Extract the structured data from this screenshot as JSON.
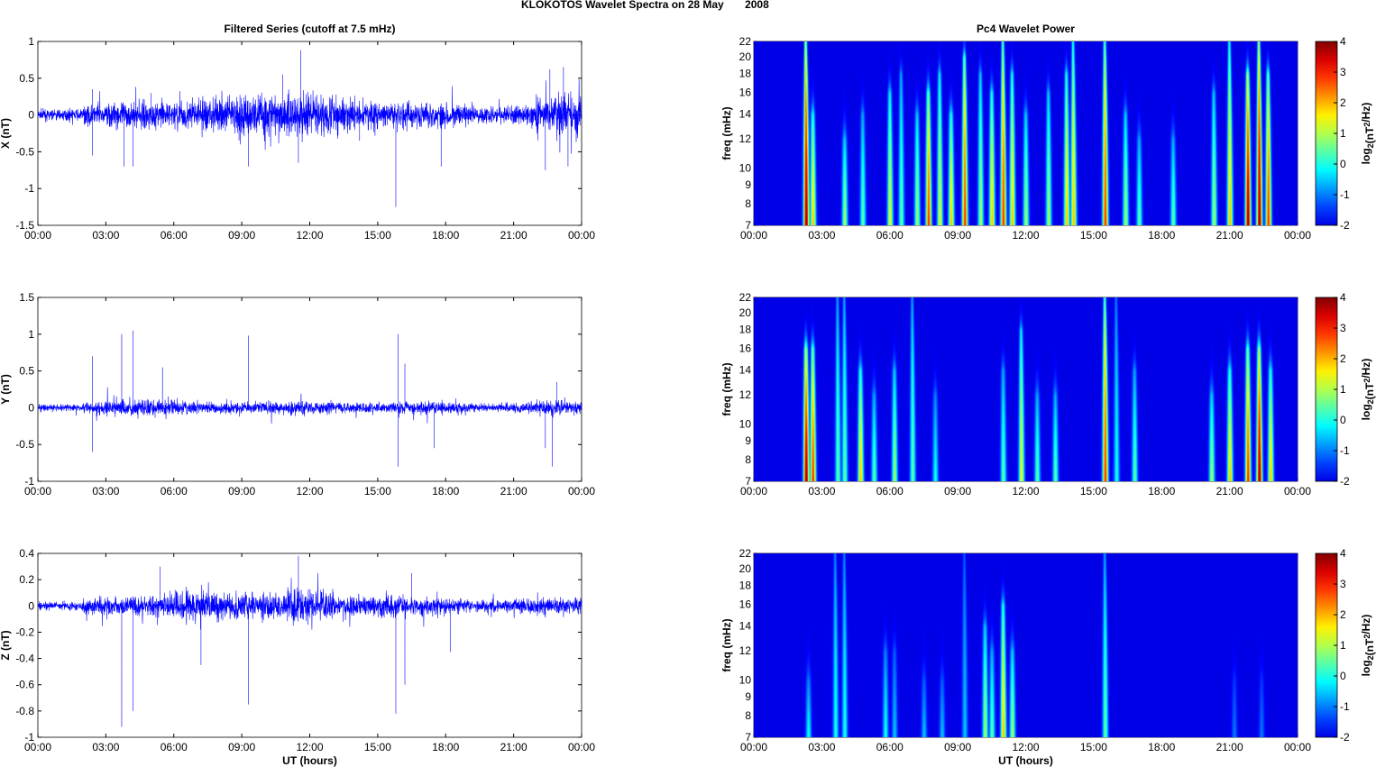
{
  "title": "KLOKOTOS Wavelet Spectra on 28 May       2008",
  "chart_data": [
    {
      "type": "line",
      "title": "Filtered Series (cutoff at 7.5 mHz)",
      "ylabel": "X (nT)",
      "xlabel": "",
      "ylim": [
        -1.5,
        1
      ],
      "yticks": [
        "1",
        "0.5",
        "0",
        "-0.5",
        "-1",
        "-1.5"
      ],
      "xticks": [
        "00:00",
        "03:00",
        "06:00",
        "09:00",
        "12:00",
        "15:00",
        "18:00",
        "21:00",
        "00:00"
      ],
      "hourly_amplitude": [
        0.05,
        0.05,
        0.1,
        0.12,
        0.12,
        0.12,
        0.13,
        0.15,
        0.17,
        0.2,
        0.2,
        0.22,
        0.18,
        0.15,
        0.13,
        0.12,
        0.12,
        0.12,
        0.1,
        0.08,
        0.08,
        0.1,
        0.16,
        0.2
      ],
      "spikes": [
        [
          2.4,
          -0.55
        ],
        [
          2.4,
          0.35
        ],
        [
          3.8,
          -0.7
        ],
        [
          4.2,
          -0.7
        ],
        [
          5.0,
          0.3
        ],
        [
          9.3,
          -0.7
        ],
        [
          11.6,
          0.88
        ],
        [
          11.5,
          -0.65
        ],
        [
          14.2,
          -0.35
        ],
        [
          15.8,
          -1.25
        ],
        [
          17.8,
          -0.7
        ],
        [
          22.4,
          -0.75
        ],
        [
          22.6,
          0.62
        ],
        [
          23.2,
          0.65
        ],
        [
          23.4,
          -0.7
        ],
        [
          10.8,
          0.55
        ]
      ]
    },
    {
      "type": "line",
      "title": "",
      "ylabel": "Y (nT)",
      "xlabel": "",
      "ylim": [
        -1,
        1.5
      ],
      "yticks": [
        "1.5",
        "1",
        "0.5",
        "0",
        "-0.5",
        "-1"
      ],
      "xticks": [
        "00:00",
        "03:00",
        "06:00",
        "09:00",
        "12:00",
        "15:00",
        "18:00",
        "21:00",
        "00:00"
      ],
      "hourly_amplitude": [
        0.03,
        0.03,
        0.06,
        0.08,
        0.08,
        0.07,
        0.06,
        0.05,
        0.05,
        0.05,
        0.06,
        0.07,
        0.06,
        0.05,
        0.05,
        0.05,
        0.06,
        0.06,
        0.05,
        0.04,
        0.04,
        0.05,
        0.07,
        0.06
      ],
      "spikes": [
        [
          2.4,
          0.7
        ],
        [
          2.4,
          -0.6
        ],
        [
          3.7,
          1.0
        ],
        [
          4.2,
          1.05
        ],
        [
          5.5,
          0.55
        ],
        [
          9.3,
          0.98
        ],
        [
          15.9,
          1.0
        ],
        [
          15.9,
          -0.8
        ],
        [
          16.2,
          0.6
        ],
        [
          17.5,
          -0.55
        ],
        [
          22.4,
          -0.55
        ],
        [
          22.7,
          -0.8
        ],
        [
          22.9,
          0.35
        ]
      ]
    },
    {
      "type": "line",
      "title": "",
      "ylabel": "Z (nT)",
      "xlabel": "UT (hours)",
      "ylim": [
        -1,
        0.4
      ],
      "yticks": [
        "0.4",
        "0.2",
        "0",
        "-0.2",
        "-0.4",
        "-0.6",
        "-0.8",
        "-1"
      ],
      "xticks": [
        "00:00",
        "03:00",
        "06:00",
        "09:00",
        "12:00",
        "15:00",
        "18:00",
        "21:00",
        "00:00"
      ],
      "hourly_amplitude": [
        0.02,
        0.02,
        0.04,
        0.05,
        0.05,
        0.06,
        0.08,
        0.08,
        0.07,
        0.07,
        0.07,
        0.09,
        0.08,
        0.05,
        0.05,
        0.06,
        0.05,
        0.05,
        0.04,
        0.03,
        0.03,
        0.04,
        0.04,
        0.04
      ],
      "spikes": [
        [
          3.7,
          -0.92
        ],
        [
          4.2,
          -0.8
        ],
        [
          7.2,
          -0.45
        ],
        [
          9.3,
          -0.75
        ],
        [
          11.5,
          0.38
        ],
        [
          15.8,
          -0.82
        ],
        [
          16.2,
          -0.6
        ],
        [
          16.5,
          0.25
        ],
        [
          18.2,
          -0.35
        ],
        [
          5.4,
          0.3
        ]
      ]
    },
    {
      "type": "heatmap",
      "title": "Pc4 Wavelet Power",
      "ylabel": "freq (mHz)",
      "xlabel": "",
      "ylim": [
        7,
        22
      ],
      "yscale": "log",
      "clim": [
        -2,
        4
      ],
      "colorbar_label": "log2(nT2/Hz)",
      "colorbar_ticks": [
        "4",
        "3",
        "2",
        "1",
        "0",
        "-1",
        "-2"
      ],
      "yticks": [
        "22",
        "20",
        "18",
        "16",
        "14",
        "12",
        "10",
        "9",
        "8",
        "7"
      ],
      "xticks": [
        "00:00",
        "03:00",
        "06:00",
        "09:00",
        "12:00",
        "15:00",
        "18:00",
        "21:00",
        "00:00"
      ],
      "events": [
        [
          2.3,
          4,
          22
        ],
        [
          2.6,
          2,
          14
        ],
        [
          4.0,
          1,
          12
        ],
        [
          4.8,
          0.5,
          14
        ],
        [
          6.0,
          1.5,
          16
        ],
        [
          6.5,
          0.5,
          18
        ],
        [
          7.2,
          1,
          14
        ],
        [
          7.7,
          3,
          16
        ],
        [
          8.2,
          1.5,
          18
        ],
        [
          8.7,
          2,
          14
        ],
        [
          9.3,
          3,
          20
        ],
        [
          10.0,
          1,
          18
        ],
        [
          10.5,
          2,
          16
        ],
        [
          11.0,
          3,
          22
        ],
        [
          11.4,
          2,
          18
        ],
        [
          12.0,
          1,
          14
        ],
        [
          13.0,
          1,
          16
        ],
        [
          13.8,
          2,
          18
        ],
        [
          14.1,
          2,
          22
        ],
        [
          15.5,
          3,
          22
        ],
        [
          16.4,
          1,
          14
        ],
        [
          17.0,
          0.5,
          12
        ],
        [
          18.5,
          0.5,
          12
        ],
        [
          20.3,
          1,
          16
        ],
        [
          21.0,
          2,
          22
        ],
        [
          21.8,
          4,
          18
        ],
        [
          22.3,
          4,
          22
        ],
        [
          22.7,
          3,
          18
        ]
      ]
    },
    {
      "type": "heatmap",
      "title": "",
      "ylabel": "freq (mHz)",
      "xlabel": "",
      "ylim": [
        7,
        22
      ],
      "yscale": "log",
      "clim": [
        -2,
        4
      ],
      "colorbar_label": "log2(nT2/Hz)",
      "colorbar_ticks": [
        "4",
        "3",
        "2",
        "1",
        "0",
        "-1",
        "-2"
      ],
      "yticks": [
        "22",
        "20",
        "18",
        "16",
        "14",
        "12",
        "10",
        "9",
        "8",
        "7"
      ],
      "xticks": [
        "00:00",
        "03:00",
        "06:00",
        "09:00",
        "12:00",
        "15:00",
        "18:00",
        "21:00",
        "00:00"
      ],
      "events": [
        [
          2.3,
          4,
          16
        ],
        [
          2.6,
          3,
          16
        ],
        [
          3.7,
          0.5,
          22
        ],
        [
          4.0,
          0.5,
          22
        ],
        [
          4.7,
          2,
          14
        ],
        [
          5.3,
          0.5,
          12
        ],
        [
          6.2,
          1,
          14
        ],
        [
          7.0,
          0.5,
          22
        ],
        [
          8.0,
          0,
          12
        ],
        [
          11.0,
          0.5,
          14
        ],
        [
          11.8,
          1.5,
          18
        ],
        [
          12.5,
          0.5,
          12
        ],
        [
          13.3,
          0.5,
          12
        ],
        [
          15.5,
          3,
          22
        ],
        [
          16.0,
          0,
          22
        ],
        [
          16.8,
          0.5,
          14
        ],
        [
          20.2,
          1,
          12
        ],
        [
          21.0,
          2,
          14
        ],
        [
          21.8,
          3,
          16
        ],
        [
          22.3,
          4,
          16
        ],
        [
          22.8,
          2,
          14
        ]
      ]
    },
    {
      "type": "heatmap",
      "title": "",
      "ylabel": "freq (mHz)",
      "xlabel": "UT (hours)",
      "ylim": [
        7,
        22
      ],
      "yscale": "log",
      "clim": [
        -2,
        4
      ],
      "colorbar_label": "log2(nT2/Hz)",
      "colorbar_ticks": [
        "4",
        "3",
        "2",
        "1",
        "0",
        "-1",
        "-2"
      ],
      "yticks": [
        "22",
        "20",
        "18",
        "16",
        "14",
        "12",
        "10",
        "9",
        "8",
        "7"
      ],
      "xticks": [
        "00:00",
        "03:00",
        "06:00",
        "09:00",
        "12:00",
        "15:00",
        "18:00",
        "21:00",
        "00:00"
      ],
      "events": [
        [
          2.4,
          0,
          10
        ],
        [
          3.6,
          0,
          22
        ],
        [
          4.0,
          0,
          22
        ],
        [
          5.8,
          0,
          12
        ],
        [
          6.2,
          -0.5,
          12
        ],
        [
          7.5,
          -0.5,
          10
        ],
        [
          8.3,
          -0.5,
          10
        ],
        [
          9.3,
          -0.5,
          22
        ],
        [
          10.2,
          1,
          14
        ],
        [
          10.5,
          0.5,
          12
        ],
        [
          11.0,
          2,
          16
        ],
        [
          11.4,
          1,
          12
        ],
        [
          15.5,
          0.5,
          22
        ],
        [
          21.2,
          -1,
          10
        ],
        [
          22.4,
          -1,
          10
        ]
      ]
    }
  ]
}
